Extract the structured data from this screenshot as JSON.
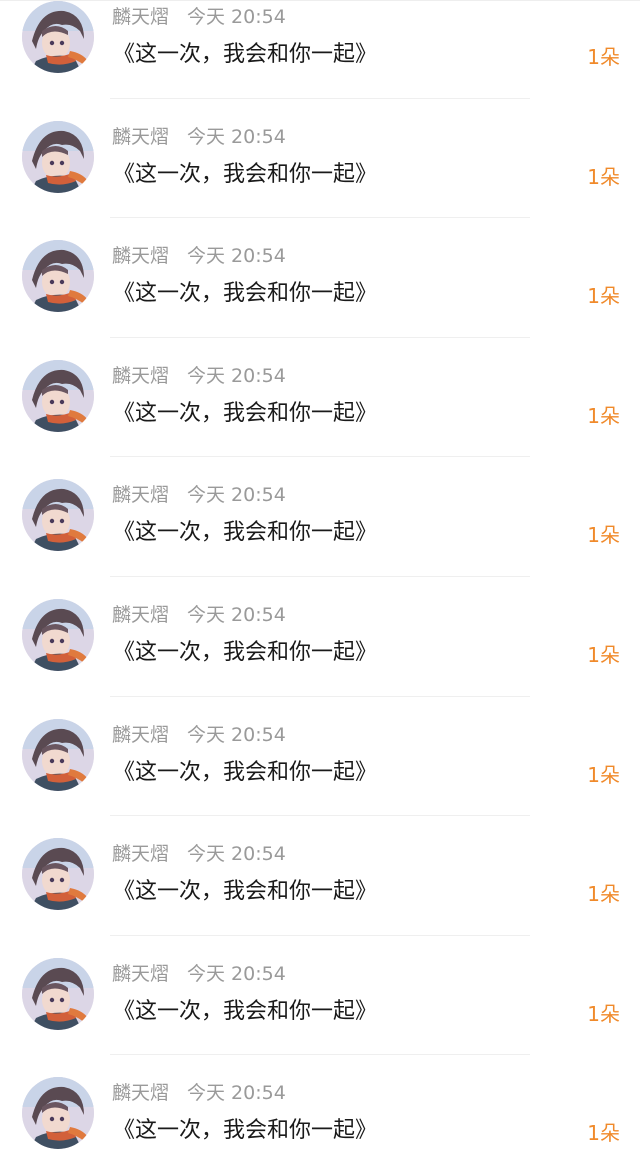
{
  "gifts": [
    {
      "user": "麟天熠",
      "time": "今天 20:54",
      "message": "《这一次，我会和你一起》",
      "count": "1朵"
    },
    {
      "user": "麟天熠",
      "time": "今天 20:54",
      "message": "《这一次，我会和你一起》",
      "count": "1朵"
    },
    {
      "user": "麟天熠",
      "time": "今天 20:54",
      "message": "《这一次，我会和你一起》",
      "count": "1朵"
    },
    {
      "user": "麟天熠",
      "time": "今天 20:54",
      "message": "《这一次，我会和你一起》",
      "count": "1朵"
    },
    {
      "user": "麟天熠",
      "time": "今天 20:54",
      "message": "《这一次，我会和你一起》",
      "count": "1朵"
    },
    {
      "user": "麟天熠",
      "time": "今天 20:54",
      "message": "《这一次，我会和你一起》",
      "count": "1朵"
    },
    {
      "user": "麟天熠",
      "time": "今天 20:54",
      "message": "《这一次，我会和你一起》",
      "count": "1朵"
    },
    {
      "user": "麟天熠",
      "time": "今天 20:54",
      "message": "《这一次，我会和你一起》",
      "count": "1朵"
    },
    {
      "user": "麟天熠",
      "time": "今天 20:54",
      "message": "《这一次，我会和你一起》",
      "count": "1朵"
    },
    {
      "user": "麟天熠",
      "time": "今天 20:54",
      "message": "《这一次，我会和你一起》",
      "count": "1朵"
    }
  ],
  "colors": {
    "count": "#f08a2b",
    "meta": "#9a9a9a",
    "message": "#1a1a1a"
  }
}
